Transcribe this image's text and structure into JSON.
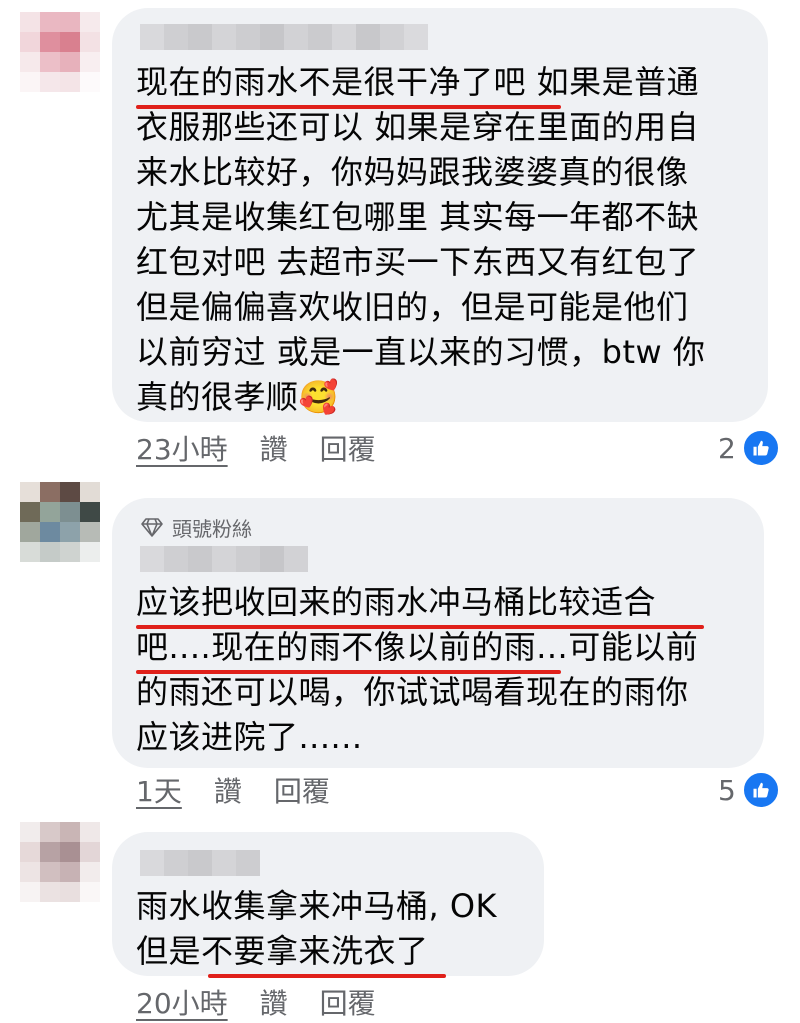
{
  "comments": [
    {
      "badge": "",
      "text": "现在的雨水不是很干净了吧 如果是普通\n衣服那些还可以 如果是穿在里面的用自\n来水比较好，你妈妈跟我婆婆真的很像\n尤其是收集红包哪里 其实每一年都不缺\n红包对吧 去超市买一下东西又有红包了\n但是偏偏喜欢收旧的，但是可能是他们\n以前穷过 或是一直以来的习惯，btw 你\n真的很孝顺🥰",
      "time": "23小時",
      "like": "讚",
      "reply": "回覆",
      "reactions": "2"
    },
    {
      "badge": "頭號粉絲",
      "text": "应该把收回来的雨水冲马桶比较适合\n吧....现在的雨不像以前的雨...可能以前\n的雨还可以喝，你试试喝看现在的雨你\n应该进院了......",
      "time": "1天",
      "like": "讚",
      "reply": "回覆",
      "reactions": "5"
    },
    {
      "badge": "",
      "text": "雨水收集拿来冲马桶, OK\n但是不要拿来洗衣了",
      "time": "20小時",
      "like": "讚",
      "reply": "回覆",
      "reactions": ""
    }
  ],
  "colors": {
    "bubble": "#eff1f4",
    "underline": "#e0201a",
    "like_blue": "#1877f2",
    "meta_text": "#65676b"
  },
  "icons": [
    "diamond-icon",
    "like-thumb-icon"
  ]
}
